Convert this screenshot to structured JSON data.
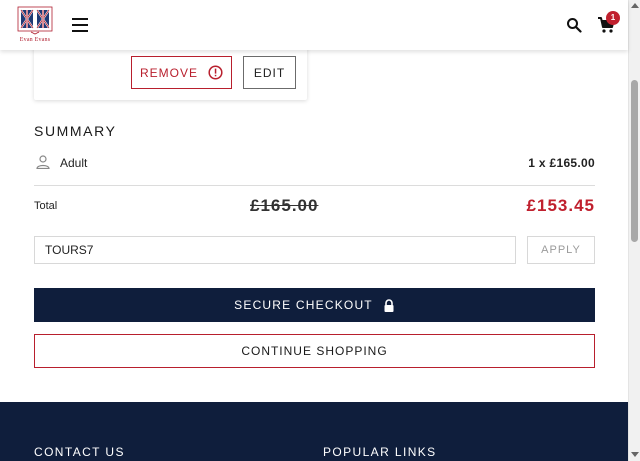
{
  "header": {
    "logo_text": "Evan Evans",
    "cart_count": "1"
  },
  "item_card": {
    "remove_label": "REMOVE",
    "edit_label": "EDIT"
  },
  "summary": {
    "title": "SUMMARY",
    "ticket_type": "Adult",
    "ticket_price": "1 x £165.00",
    "total_label": "Total",
    "original_total": "£165.00",
    "discounted_total": "£153.45"
  },
  "promo": {
    "code": "TOURS7",
    "apply_label": "APPLY"
  },
  "actions": {
    "checkout_label": "SECURE CHECKOUT",
    "continue_label": "CONTINUE SHOPPING"
  },
  "footer": {
    "contact_label": "CONTACT US",
    "links_label": "POPULAR LINKS"
  },
  "colors": {
    "navy": "#0f1e3c",
    "accent_red": "#c0202e"
  },
  "icons": [
    "logo-icon",
    "menu-icon",
    "search-icon",
    "cart-icon",
    "alert-icon",
    "user-icon",
    "lock-icon"
  ]
}
